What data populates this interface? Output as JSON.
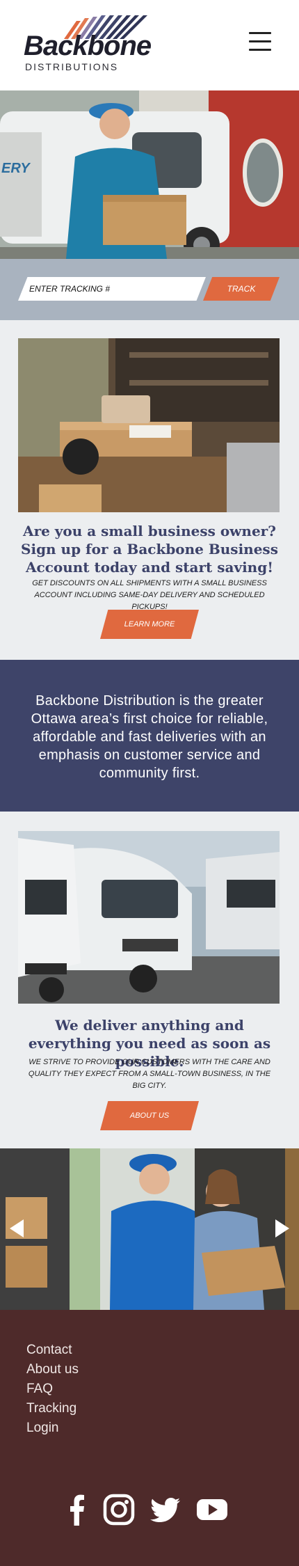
{
  "header": {
    "logo_word": "Backbone",
    "logo_sub": "DISTRIBUTIONS",
    "menu_icon": "hamburger-icon"
  },
  "hero": {
    "image": "courier-holding-box-by-van"
  },
  "tracking": {
    "placeholder": "ENTER TRACKING #",
    "button_label": "TRACK"
  },
  "small_business": {
    "image": "warehouse-worker-scanning-parcels",
    "headline": "Are you a small business owner? Sign up for a Backbone Business Account today and start saving!",
    "subtext": "Get discounts on all shipments with a small business account including same-day delivery  and scheduled pickups!",
    "button_label": "LEARN MORE"
  },
  "about_band": {
    "text": "Backbone Distribution is the greater Ottawa area’s first choice for reliable, affordable and fast deliveries with an emphasis on customer service and community first."
  },
  "deliver": {
    "image": "fleet-of-white-vans",
    "headline": "We deliver anything and everything you need as soon as possible.",
    "subtext": "We strive to provide our customers with the care and quality they expect from a small-town business, in the big city.",
    "button_label": "ABOUT US"
  },
  "carousel": {
    "image": "courier-handing-package-to-customer",
    "prev_icon": "arrow-left-icon",
    "next_icon": "arrow-right-icon"
  },
  "footer": {
    "links": [
      "Contact",
      "About us",
      "FAQ",
      "Tracking",
      "Login"
    ],
    "socials": [
      "facebook-icon",
      "instagram-icon",
      "twitter-icon",
      "youtube-icon"
    ]
  },
  "colors": {
    "accent": "#e0693f",
    "navy": "#3e4469",
    "headline": "#3c4269",
    "footer_bg": "#4e2a2a",
    "track_bar": "#a9b3bf",
    "section_bg": "#eceef0"
  }
}
